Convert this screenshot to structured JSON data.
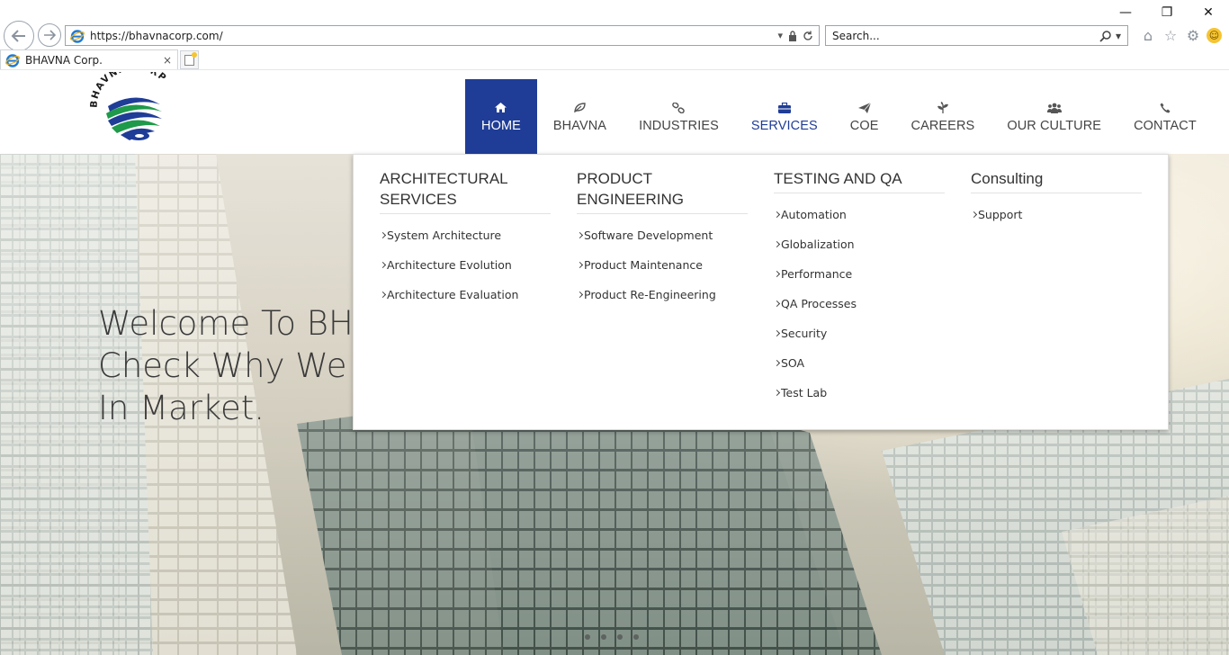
{
  "browser": {
    "url": "https://bhavnacorp.com/",
    "search_placeholder": "Search...",
    "tab_title": "BHAVNA Corp.",
    "tab_close": "×",
    "win_minimize": "—",
    "win_restore": "❐",
    "win_close": "✕"
  },
  "logo": {
    "text": "BHAVNA CORP",
    "colors": {
      "navy": "#1f3d97",
      "green": "#1e9a4a"
    }
  },
  "nav": {
    "items": [
      {
        "label": "HOME",
        "icon": "home-icon"
      },
      {
        "label": "BHAVNA",
        "icon": "leaf-icon"
      },
      {
        "label": "INDUSTRIES",
        "icon": "link-icon"
      },
      {
        "label": "SERVICES",
        "icon": "briefcase-icon"
      },
      {
        "label": "COE",
        "icon": "paper-plane-icon"
      },
      {
        "label": "CAREERS",
        "icon": "pagelines-icon"
      },
      {
        "label": "OUR CULTURE",
        "icon": "users-icon"
      },
      {
        "label": "CONTACT",
        "icon": "phone-icon"
      }
    ],
    "active_color": "#1f3d97"
  },
  "hero": {
    "line1": "Welcome To BH",
    "line2": "Check Why We",
    "line3": "In Market."
  },
  "mega_menu": {
    "columns": [
      {
        "title": "ARCHITECTURAL SERVICES",
        "items": [
          "System Architecture",
          "Architecture Evolution",
          "Architecture Evaluation"
        ]
      },
      {
        "title": "PRODUCT ENGINEERING",
        "items": [
          "Software Development",
          "Product Maintenance",
          "Product Re-Engineering"
        ]
      },
      {
        "title": "TESTING AND QA",
        "items": [
          "Automation",
          "Globalization",
          "Performance",
          "QA Processes",
          "Security",
          "SOA",
          "Test Lab"
        ]
      },
      {
        "title": "Consulting",
        "items": [
          "Support"
        ]
      }
    ]
  }
}
